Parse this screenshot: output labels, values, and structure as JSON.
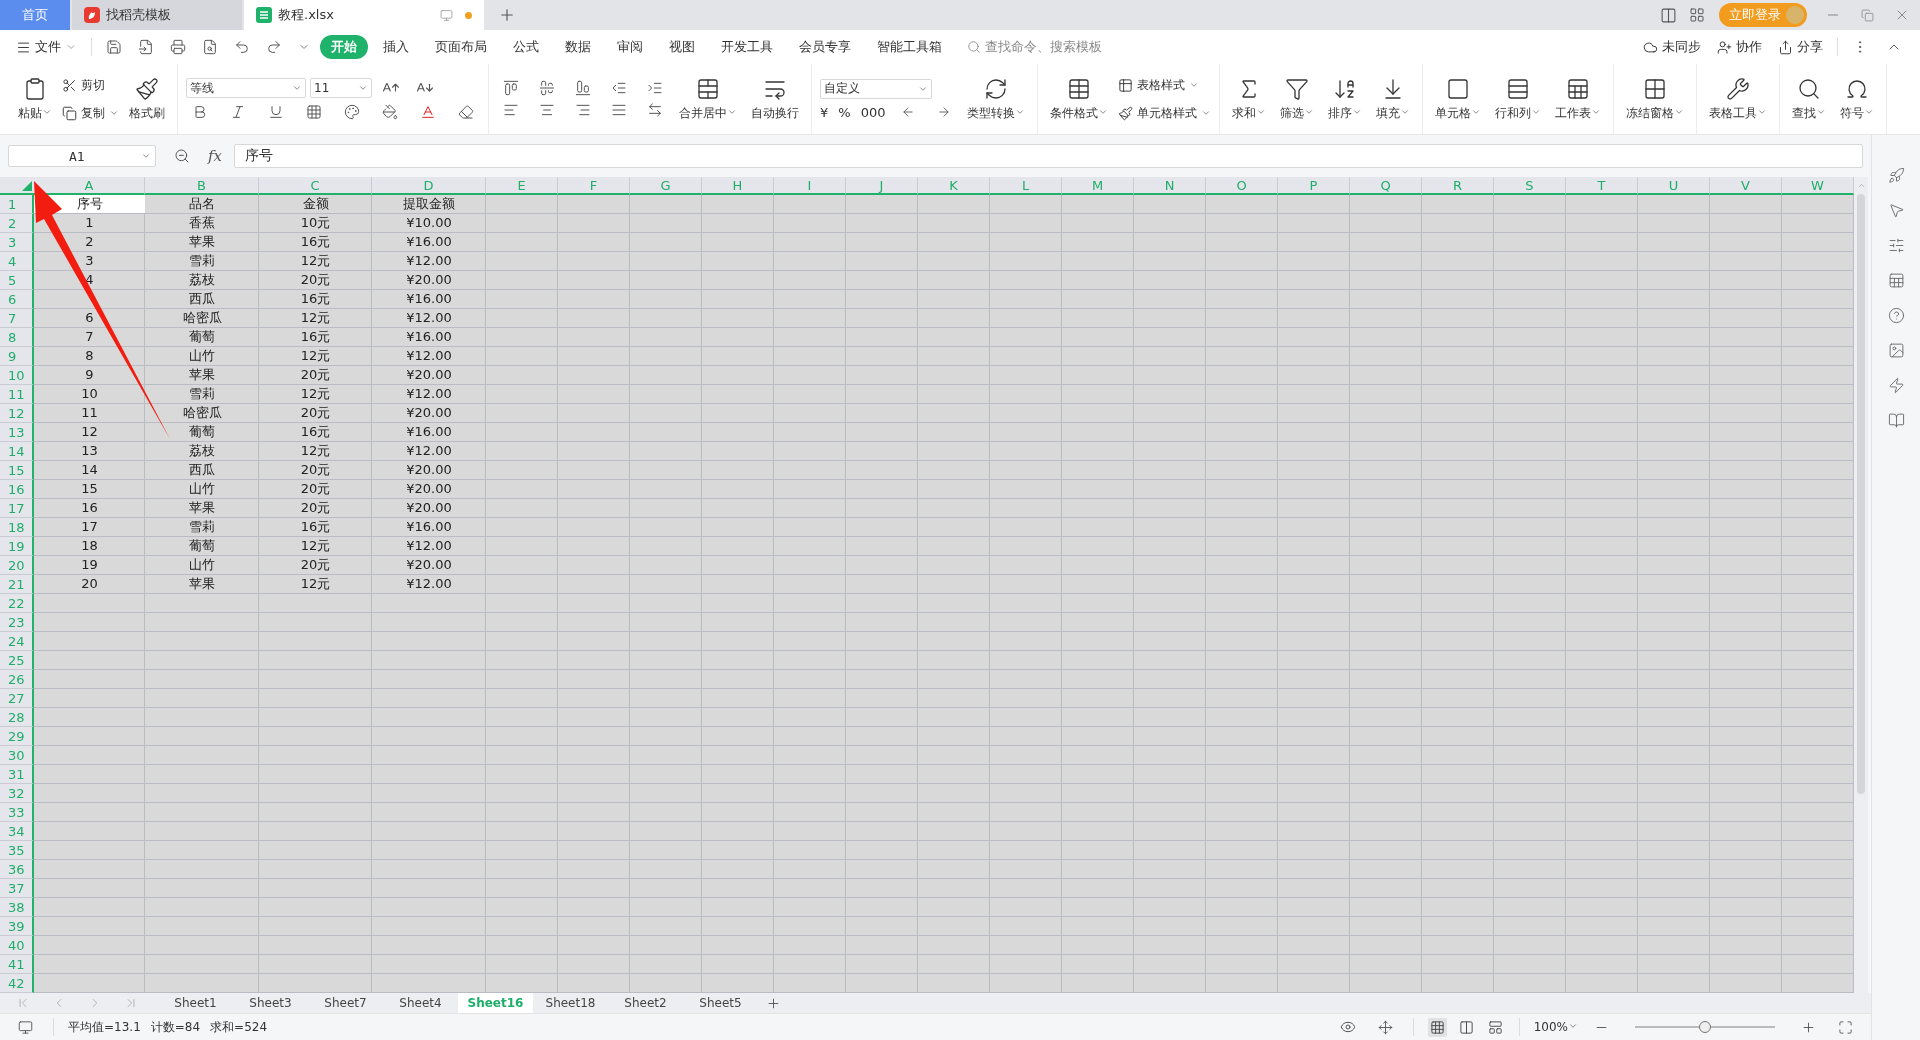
{
  "title_bar": {
    "tabs": [
      {
        "label": "首页",
        "kind": "home",
        "selected": false,
        "modified": false
      },
      {
        "label": "找稻壳模板",
        "kind": "template",
        "selected": false,
        "modified": false
      },
      {
        "label": "教程.xlsx",
        "kind": "sheet",
        "selected": true,
        "modified": true
      }
    ],
    "login_button": "立即登录"
  },
  "menu_bar": {
    "file": "文件",
    "items": [
      {
        "label": "开始",
        "selected": true
      },
      {
        "label": "插入",
        "selected": false
      },
      {
        "label": "页面布局",
        "selected": false
      },
      {
        "label": "公式",
        "selected": false
      },
      {
        "label": "数据",
        "selected": false
      },
      {
        "label": "审阅",
        "selected": false
      },
      {
        "label": "视图",
        "selected": false
      },
      {
        "label": "开发工具",
        "selected": false
      },
      {
        "label": "会员专享",
        "selected": false
      },
      {
        "label": "智能工具箱",
        "selected": false
      }
    ],
    "search": {
      "placeholder": "查找命令、搜索模板"
    },
    "actions": [
      "未同步",
      "协作",
      "分享"
    ]
  },
  "ribbon": [
    {
      "kind": "clipboard",
      "paste": "粘贴",
      "cut": "剪切",
      "copy": "复制",
      "painter": "格式刷"
    },
    {
      "kind": "font",
      "name": "等线",
      "size": "11"
    },
    {
      "kind": "align",
      "merge": "合并居中",
      "wrap": "自动换行"
    },
    {
      "kind": "number",
      "format": "自定义",
      "symbols": [
        "¥",
        "%",
        "000"
      ],
      "convert": "类型转换"
    },
    {
      "kind": "styles",
      "conditional": "条件格式",
      "table_style": "表格样式",
      "cell_style": "单元格样式"
    },
    {
      "kind": "large",
      "items": [
        "求和",
        "筛选",
        "排序",
        "填充"
      ]
    },
    {
      "kind": "large",
      "items": [
        "单元格",
        "行和列",
        "工作表"
      ]
    },
    {
      "kind": "large",
      "items": [
        "冻结窗格"
      ]
    },
    {
      "kind": "large",
      "items": [
        "表格工具"
      ]
    },
    {
      "kind": "large",
      "items": [
        "查找",
        "符号"
      ]
    }
  ],
  "formula_bar": {
    "name_box": "A1",
    "fx": "fx",
    "formula": "序号"
  },
  "sheet": {
    "all_selected": true,
    "column_headers": [
      "A",
      "B",
      "C",
      "D",
      "E",
      "F",
      "G",
      "H",
      "I",
      "J",
      "K",
      "L",
      "M",
      "N",
      "O",
      "P",
      "Q",
      "R",
      "S",
      "T",
      "U",
      "V",
      "W"
    ],
    "row_headers": [
      "1",
      "2",
      "3",
      "4",
      "5",
      "6",
      "7",
      "8",
      "9",
      "10",
      "11",
      "12",
      "13",
      "14",
      "15",
      "16",
      "17",
      "18",
      "19",
      "20",
      "21",
      "22",
      "23",
      "24",
      "25",
      "26",
      "27",
      "28",
      "29",
      "30",
      "31",
      "32",
      "33",
      "34",
      "35",
      "36",
      "37",
      "38",
      "39",
      "40",
      "41",
      "42"
    ],
    "rows": [
      [
        "序号",
        "品名",
        "金额",
        "提取金额"
      ],
      [
        "1",
        "香蕉",
        "10元",
        "¥10.00"
      ],
      [
        "2",
        "苹果",
        "16元",
        "¥16.00"
      ],
      [
        "3",
        "雪莉",
        "12元",
        "¥12.00"
      ],
      [
        "4",
        "荔枝",
        "20元",
        "¥20.00"
      ],
      [
        null,
        "西瓜",
        "16元",
        "¥16.00"
      ],
      [
        "6",
        "哈密瓜",
        "12元",
        "¥12.00"
      ],
      [
        "7",
        "葡萄",
        "16元",
        "¥16.00"
      ],
      [
        "8",
        "山竹",
        "12元",
        "¥12.00"
      ],
      [
        "9",
        "苹果",
        "20元",
        "¥20.00"
      ],
      [
        "10",
        "雪莉",
        "12元",
        "¥12.00"
      ],
      [
        "11",
        "哈密瓜",
        "20元",
        "¥20.00"
      ],
      [
        "12",
        "葡萄",
        "16元",
        "¥16.00"
      ],
      [
        "13",
        "荔枝",
        "12元",
        "¥12.00"
      ],
      [
        "14",
        "西瓜",
        "20元",
        "¥20.00"
      ],
      [
        "15",
        "山竹",
        "20元",
        "¥20.00"
      ],
      [
        "16",
        "苹果",
        "20元",
        "¥20.00"
      ],
      [
        "17",
        "雪莉",
        "16元",
        "¥16.00"
      ],
      [
        "18",
        "葡萄",
        "12元",
        "¥12.00"
      ],
      [
        "19",
        "山竹",
        "20元",
        "¥20.00"
      ],
      [
        "20",
        "苹果",
        "12元",
        "¥12.00"
      ]
    ]
  },
  "sheet_tabs": [
    {
      "label": "Sheet1",
      "selected": false
    },
    {
      "label": "Sheet3",
      "selected": false
    },
    {
      "label": "Sheet7",
      "selected": false
    },
    {
      "label": "Sheet4",
      "selected": false
    },
    {
      "label": "Sheet16",
      "selected": true
    },
    {
      "label": "Sheet18",
      "selected": false
    },
    {
      "label": "Sheet2",
      "selected": false
    },
    {
      "label": "Sheet5",
      "selected": false
    }
  ],
  "status_bar": {
    "stats": [
      "平均值=13.1",
      "计数=84",
      "求和=524"
    ],
    "zoom": "100%",
    "zoom_slider": {
      "level": 0.5
    }
  }
}
